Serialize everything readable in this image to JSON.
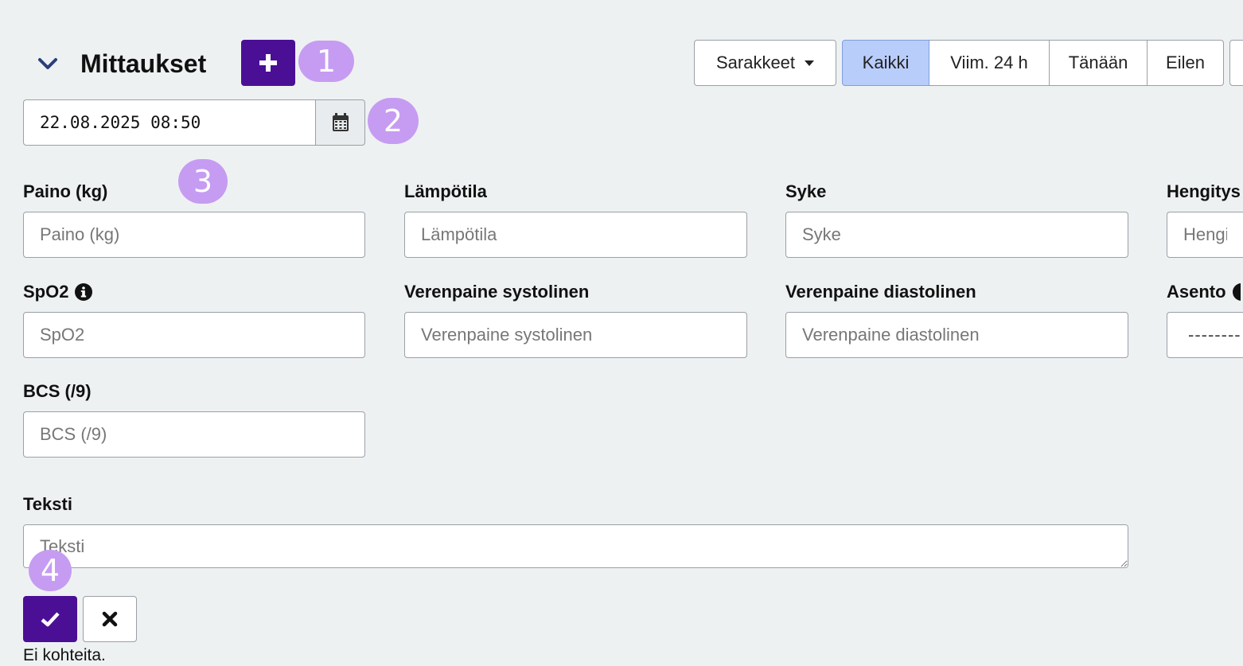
{
  "header": {
    "title": "Mittaukset"
  },
  "badges": [
    "1",
    "2",
    "3",
    "4"
  ],
  "toolbar": {
    "columns_label": "Sarakkeet",
    "ranges": [
      {
        "label": "Kaikki",
        "active": true
      },
      {
        "label": "Viim. 24 h",
        "active": false
      },
      {
        "label": "Tänään",
        "active": false
      },
      {
        "label": "Eilen",
        "active": false
      }
    ]
  },
  "date_field": {
    "value": "22.08.2025 08:50"
  },
  "fields": {
    "weight": {
      "label": "Paino (kg)",
      "placeholder": "Paino (kg)"
    },
    "temperature": {
      "label": "Lämpötila",
      "placeholder": "Lämpötila"
    },
    "pulse": {
      "label": "Syke",
      "placeholder": "Syke"
    },
    "respiration": {
      "label": "Hengitys",
      "placeholder": "Hengit"
    },
    "spo2": {
      "label": "SpO2",
      "placeholder": "SpO2"
    },
    "bp_systolic": {
      "label": "Verenpaine systolinen",
      "placeholder": "Verenpaine systolinen"
    },
    "bp_diastolic": {
      "label": "Verenpaine diastolinen",
      "placeholder": "Verenpaine diastolinen"
    },
    "position": {
      "label": "Asento",
      "selected": "--------"
    },
    "bcs": {
      "label": "BCS (/9)",
      "placeholder": "BCS (/9)"
    },
    "text": {
      "label": "Teksti",
      "placeholder": "Teksti"
    }
  },
  "status": {
    "empty": "Ei kohteita."
  },
  "colors": {
    "primary": "#4b0f96",
    "badge": "#c69cf2",
    "active_filter": "#b9cdfb",
    "background": "#eef1f2"
  }
}
